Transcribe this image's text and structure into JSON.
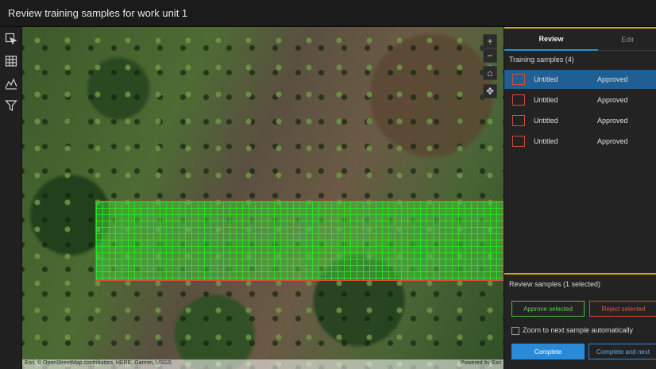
{
  "window": {
    "title": "Review training samples for work unit 1"
  },
  "toolbar": {
    "tools": [
      {
        "icon": "select-features-icon"
      },
      {
        "icon": "attribute-table-icon"
      },
      {
        "icon": "chart-line-icon"
      },
      {
        "icon": "filter-icon"
      }
    ]
  },
  "map": {
    "controls": [
      {
        "label": "+",
        "icon": "zoom-in-icon"
      },
      {
        "label": "−",
        "icon": "zoom-out-icon"
      },
      {
        "label": "⌂",
        "icon": "home-icon"
      },
      {
        "label": "✥",
        "icon": "pan-icon"
      }
    ],
    "attribution_left": "Esri, © OpenStreetMap contributors, HERE, Garmin, USGS",
    "attribution_right": "Powered by Esri"
  },
  "panel": {
    "tabs": [
      {
        "label": "Review",
        "active": true
      },
      {
        "label": "Edit",
        "active": false
      }
    ],
    "samples_title": "Training samples (4)",
    "samples": [
      {
        "name": "Untitled",
        "status": "Approved",
        "selected": true
      },
      {
        "name": "Untitled",
        "status": "Approved",
        "selected": false
      },
      {
        "name": "Untitled",
        "status": "Approved",
        "selected": false
      },
      {
        "name": "Untitled",
        "status": "Approved",
        "selected": false
      }
    ],
    "review_title": "Review samples (1 selected)",
    "approve_label": "Approve selected",
    "reject_label": "Reject selected",
    "zoom_next_label": "Zoom to next sample automatically",
    "zoom_next_checked": false,
    "complete_label": "Complete",
    "complete_next_label": "Complete and next"
  },
  "colors": {
    "accent": "#2b8ad8",
    "highlight": "#d9a400",
    "approve": "#43c23b",
    "reject": "#d84a3e"
  }
}
